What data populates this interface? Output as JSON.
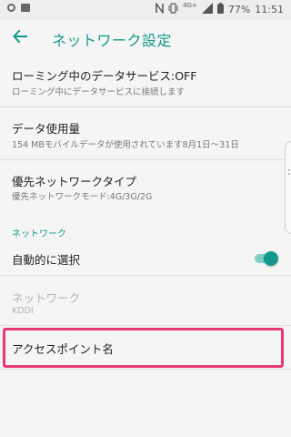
{
  "status_bar": {
    "network_type": "4G+",
    "battery_percent": "77%",
    "time": "11:51",
    "icons": [
      "sync-circle-icon",
      "photo-icon",
      "nfc-icon",
      "vibrate-icon",
      "signal-icon",
      "battery-icon"
    ]
  },
  "app_bar": {
    "back_icon": "back-arrow-icon",
    "title": "ネットワーク設定"
  },
  "settings": {
    "roaming": {
      "title": "ローミング中のデータサービス:OFF",
      "summary": "ローミング中にデータサービスに接続します"
    },
    "data_usage": {
      "title": "データ使用量",
      "summary": "154 MBモバイルデータが使用されています8月1日〜31日"
    },
    "preferred_network": {
      "title": "優先ネットワークタイプ",
      "summary": "優先ネットワークモード:4G/3G/2G"
    },
    "network_section": {
      "header": "ネットワーク",
      "auto_select": {
        "title": "自動的に選択",
        "enabled": true
      },
      "network": {
        "title": "ネットワーク",
        "summary": "KDDI",
        "disabled": true
      }
    },
    "access_point": {
      "title": "アクセスポイント名",
      "highlighted": true
    }
  },
  "colors": {
    "accent": "#139a8a",
    "highlight": "#e6396f",
    "background": "#f5f5f5"
  }
}
